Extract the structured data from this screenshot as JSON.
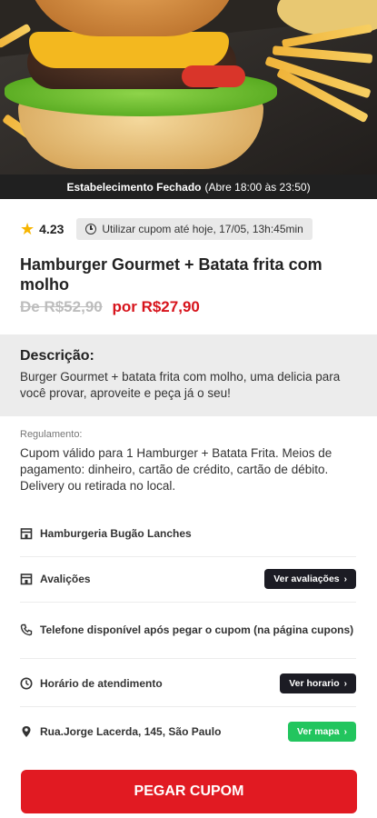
{
  "status": {
    "main": "Estabelecimento Fechado",
    "hours": "(Abre 18:00 às 23:50)"
  },
  "rating": "4.23",
  "coupon_validity": "Utilizar cupom até hoje, 17/05, 13h:45min",
  "title": "Hamburger Gourmet + Batata frita com molho",
  "price_old": "De R$52,90",
  "price_new": "por R$27,90",
  "description": {
    "heading": "Descrição:",
    "text": "Burger Gourmet + batata frita com molho, uma delicia para você provar, aproveite e peça já o seu!"
  },
  "regulation": {
    "label": "Regulamento:",
    "text": "Cupom válido para 1 Hamburger + Batata Frita. Meios de pagamento: dinheiro, cartão de crédito, cartão de débito. Delivery ou retirada no local."
  },
  "info": {
    "store": "Hamburgeria Bugão Lanches",
    "reviews": "Avalições",
    "reviews_button": "Ver avaliações",
    "phone": "Telefone disponível após pegar o cupom (na página cupons)",
    "hours": "Horário de atendimento",
    "hours_button": "Ver horario",
    "address": "Rua.Jorge Lacerda, 145, São Paulo",
    "map_button": "Ver mapa"
  },
  "cta": "PEGAR CUPOM",
  "icons": [
    "star-icon",
    "clock-icon",
    "store-icon",
    "reviews-icon",
    "phone-icon",
    "pin-icon",
    "chevron-right-icon"
  ],
  "colors": {
    "accent": "#e11a22",
    "price": "#d7141c",
    "dark_button": "#1c1c24",
    "green_button": "#22c55e",
    "star": "#f7b500"
  }
}
